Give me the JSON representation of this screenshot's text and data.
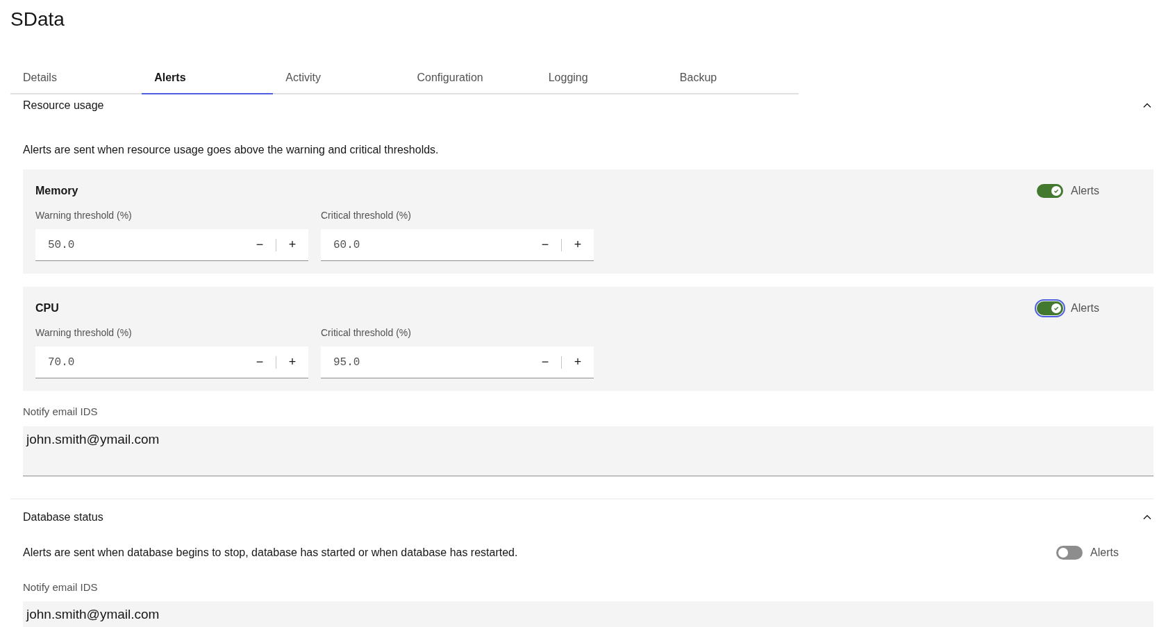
{
  "title": "SData",
  "tabs": [
    {
      "label": "Details",
      "selected": false
    },
    {
      "label": "Alerts",
      "selected": true
    },
    {
      "label": "Activity",
      "selected": false
    },
    {
      "label": "Configuration",
      "selected": false
    },
    {
      "label": "Logging",
      "selected": false
    },
    {
      "label": "Backup",
      "selected": false
    }
  ],
  "sections": [
    {
      "heading": "Resource usage",
      "expanded": true,
      "description": "Alerts are sent when resource usage goes above the warning and critical thresholds.",
      "groups": [
        {
          "name": "Memory",
          "toggle": {
            "label": "Alerts",
            "on": true,
            "focused": false
          },
          "fields": [
            {
              "label": "Warning threshold (%)",
              "value": "50.0",
              "minus": "−",
              "plus": "+"
            },
            {
              "label": "Critical threshold (%)",
              "value": "60.0",
              "minus": "−",
              "plus": "+"
            }
          ]
        },
        {
          "name": "CPU",
          "toggle": {
            "label": "Alerts",
            "on": true,
            "focused": true
          },
          "fields": [
            {
              "label": "Warning threshold (%)",
              "value": "70.0",
              "minus": "−",
              "plus": "+"
            },
            {
              "label": "Critical threshold (%)",
              "value": "95.0",
              "minus": "−",
              "plus": "+"
            }
          ]
        }
      ],
      "email": {
        "label": "Notify email IDS",
        "value": "john.smith@ymail.com"
      }
    },
    {
      "heading": "Database status",
      "expanded": true,
      "description": "Alerts are sent when database begins to stop, database has started or when database has restarted.",
      "toggle": {
        "label": "Alerts",
        "on": false,
        "focused": false
      },
      "email": {
        "label": "Notify email IDS",
        "value": "john.smith@ymail.com"
      }
    }
  ]
}
